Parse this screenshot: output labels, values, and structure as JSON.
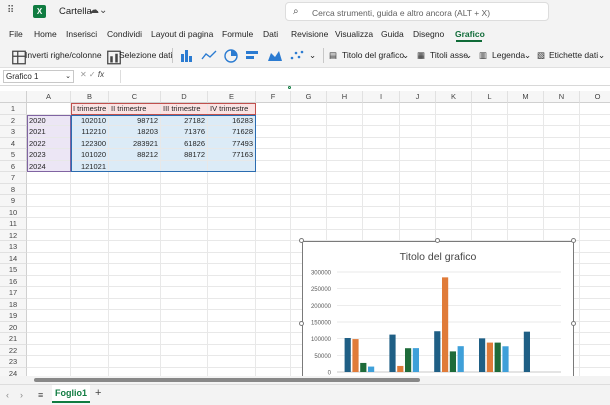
{
  "app": {
    "title": "Cartella",
    "logo_letter": "X"
  },
  "search": {
    "placeholder": "Cerca strumenti, guida e altro ancora (ALT + X)"
  },
  "menu": [
    "File",
    "Home",
    "Inserisci",
    "Condividi",
    "Layout di pagina",
    "Formule",
    "Dati",
    "Revisione",
    "Visualizza",
    "Guida",
    "Disegno",
    "Grafico"
  ],
  "menu_active": "Grafico",
  "ribbon": {
    "swap_rows_cols": "Inverti righe/colonne",
    "select_data": "Selezione dati",
    "chart_title": "Titolo del grafico",
    "axis_titles": "Titoli asse",
    "legend": "Legenda",
    "data_labels": "Etichette dati"
  },
  "namebox": "Grafico 1",
  "columns": [
    "A",
    "B",
    "C",
    "D",
    "E",
    "F",
    "G",
    "H",
    "I",
    "J",
    "K",
    "L",
    "M",
    "N",
    "O"
  ],
  "rows": [
    "1",
    "2",
    "3",
    "4",
    "5",
    "6",
    "7",
    "8",
    "9",
    "10",
    "11",
    "12",
    "13",
    "14",
    "15",
    "16",
    "17",
    "18",
    "19",
    "20",
    "21",
    "22",
    "23",
    "24"
  ],
  "table": {
    "headers": [
      "I trimestre",
      "II trimestre",
      "III trimestre",
      "IV trimestre"
    ],
    "years": [
      "2020",
      "2021",
      "2022",
      "2023",
      "2024"
    ],
    "values": [
      [
        "102010",
        "98712",
        "27182",
        "16283"
      ],
      [
        "112210",
        "18203",
        "71376",
        "71628"
      ],
      [
        "122300",
        "283921",
        "61826",
        "77493"
      ],
      [
        "101020",
        "88212",
        "88172",
        "77163"
      ],
      [
        "121021",
        "",
        "",
        ""
      ]
    ]
  },
  "chart_data": {
    "type": "bar",
    "title": "Titolo del grafico",
    "categories": [
      "2020",
      "2021",
      "2022",
      "2023",
      "2024"
    ],
    "series": [
      {
        "name": "I trimestre",
        "values": [
          102010,
          112210,
          122300,
          101020,
          121021
        ],
        "color": "#1f5f85"
      },
      {
        "name": "II trimestre",
        "values": [
          98712,
          18203,
          283921,
          88212,
          0
        ],
        "color": "#e07b39"
      },
      {
        "name": "III trimestre",
        "values": [
          27182,
          71376,
          61826,
          88172,
          0
        ],
        "color": "#1e6b3a"
      },
      {
        "name": "IV trimestre",
        "values": [
          16283,
          71628,
          77493,
          77163,
          0
        ],
        "color": "#3fa0d9"
      }
    ],
    "yticks": [
      "300000",
      "250000",
      "200000",
      "150000",
      "100000",
      "50000",
      "0"
    ],
    "ylim": [
      0,
      300000
    ],
    "grid": true,
    "legend_position": "bottom"
  },
  "sheet_tab": "Foglio1"
}
